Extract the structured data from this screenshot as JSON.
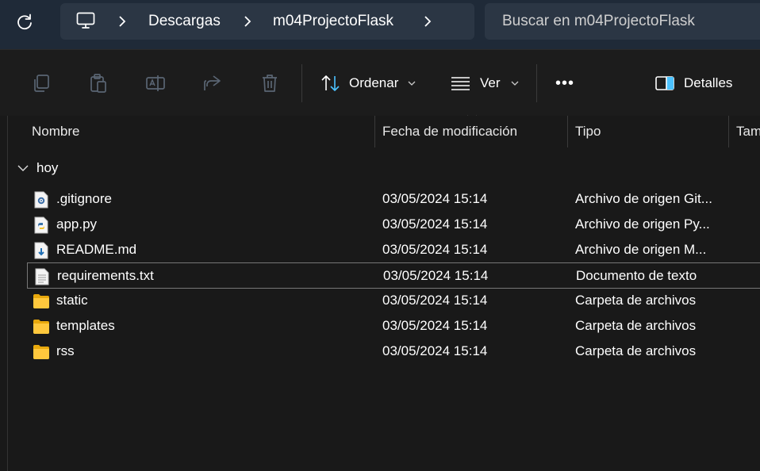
{
  "address_bar": {
    "breadcrumbs": [
      "Descargas",
      "m04ProjectoFlask"
    ],
    "search_placeholder": "Buscar en m04ProjectoFlask"
  },
  "toolbar": {
    "sort_label": "Ordenar",
    "view_label": "Ver",
    "more_label": "•••",
    "details_label": "Detalles"
  },
  "columns": {
    "name": "Nombre",
    "modified": "Fecha de modificación",
    "type": "Tipo",
    "size": "Tam"
  },
  "group_label": "hoy",
  "files": [
    {
      "name": ".gitignore",
      "modified": "03/05/2024 15:14",
      "type": "Archivo de origen Git...",
      "icon": "gear-file-icon"
    },
    {
      "name": "app.py",
      "modified": "03/05/2024 15:14",
      "type": "Archivo de origen Py...",
      "icon": "python-file-icon"
    },
    {
      "name": "README.md",
      "modified": "03/05/2024 15:14",
      "type": "Archivo de origen M...",
      "icon": "markdown-file-icon"
    },
    {
      "name": "requirements.txt",
      "modified": "03/05/2024 15:14",
      "type": "Documento de texto",
      "icon": "text-file-icon"
    },
    {
      "name": "static",
      "modified": "03/05/2024 15:14",
      "type": "Carpeta de archivos",
      "icon": "folder-icon"
    },
    {
      "name": "templates",
      "modified": "03/05/2024 15:14",
      "type": "Carpeta de archivos",
      "icon": "folder-icon"
    },
    {
      "name": "rss",
      "modified": "03/05/2024 15:14",
      "type": "Carpeta de archivos",
      "icon": "folder-icon"
    }
  ],
  "selected_file": "requirements.txt",
  "colors": {
    "accent": "#4cc2ff",
    "folder": "#ffc83d",
    "background": "#191919"
  }
}
